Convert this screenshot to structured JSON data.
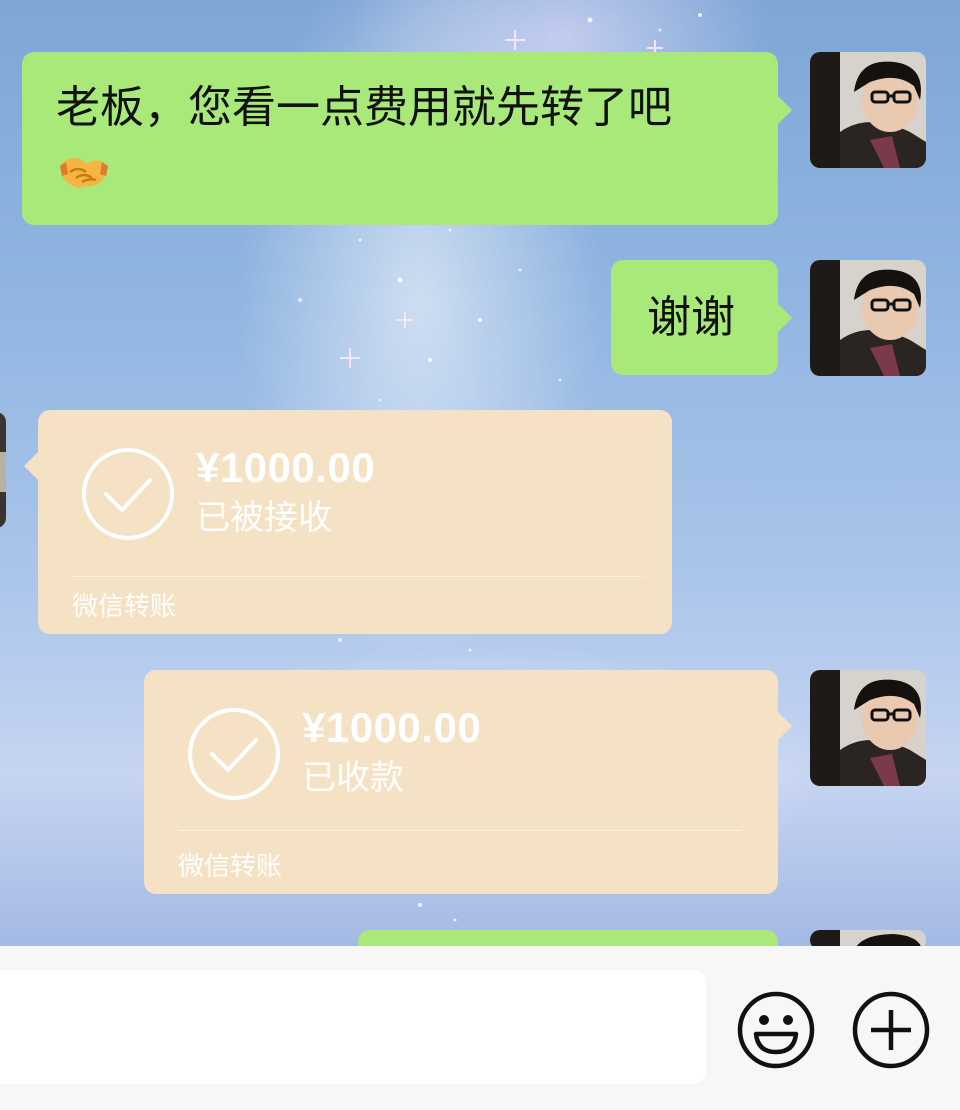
{
  "messages": [
    {
      "type": "text",
      "side": "right",
      "text": "老板，您看一点费用就先转了吧",
      "emoji": "handshake-emoji"
    },
    {
      "type": "text",
      "side": "right",
      "text": "谢谢"
    },
    {
      "type": "transfer",
      "side": "left",
      "amount": "¥1000.00",
      "status": "已被接收",
      "footer": "微信转账"
    },
    {
      "type": "transfer",
      "side": "right",
      "amount": "¥1000.00",
      "status": "已收款",
      "footer": "微信转账"
    }
  ],
  "input_bar": {
    "value": "",
    "emoji_button_icon": "smiley-icon",
    "more_button_icon": "plus-circle-icon"
  },
  "colors": {
    "text_bubble": "#a8e97a",
    "transfer_card": "#f5e1c4",
    "input_bar_bg": "#f7f7f7"
  }
}
